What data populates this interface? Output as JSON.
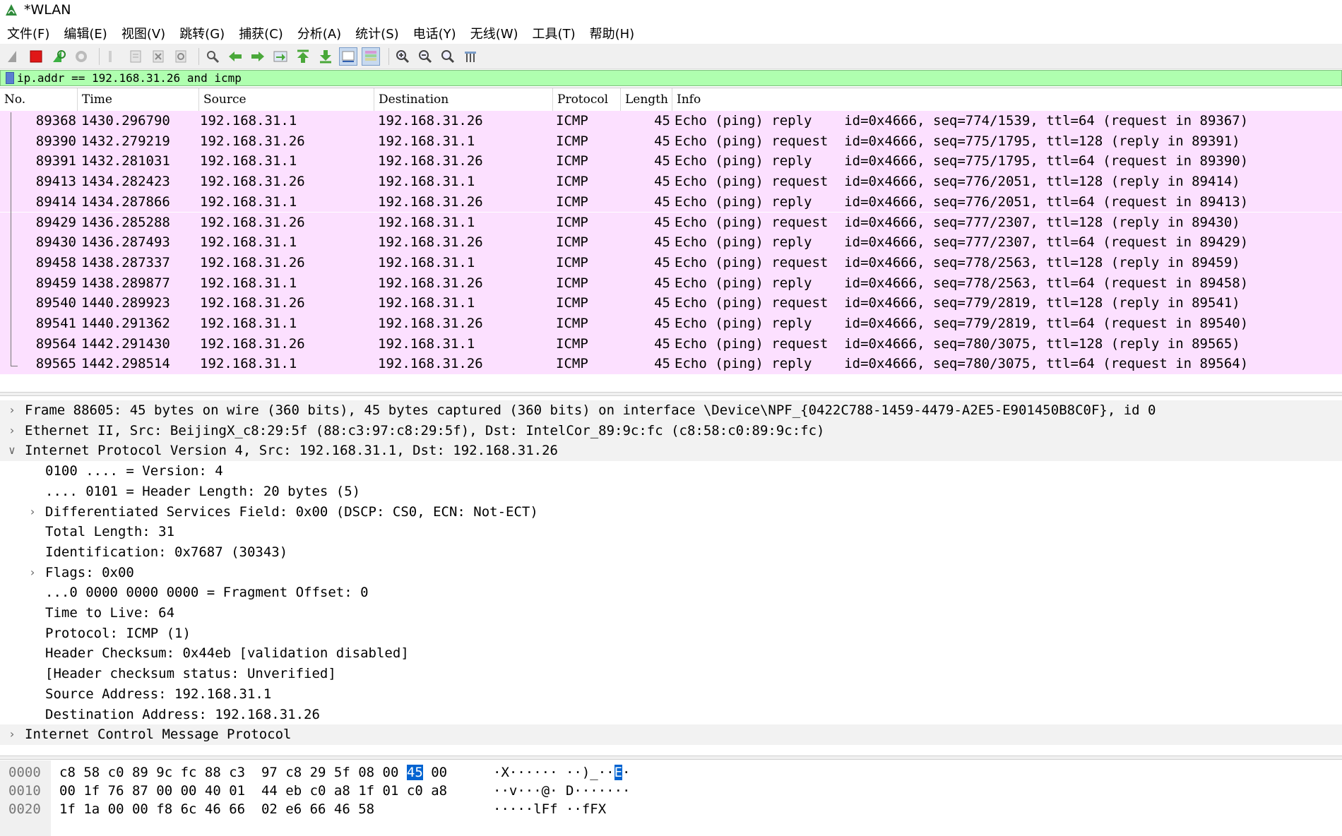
{
  "window": {
    "title": "*WLAN"
  },
  "menu": [
    "文件(F)",
    "编辑(E)",
    "视图(V)",
    "跳转(G)",
    "捕获(C)",
    "分析(A)",
    "统计(S)",
    "电话(Y)",
    "无线(W)",
    "工具(T)",
    "帮助(H)"
  ],
  "toolbar": {
    "icons": [
      "shark-fin-start-icon",
      "stop-capture-icon",
      "restart-capture-icon",
      "capture-options-icon",
      "open-file-icon",
      "save-file-icon",
      "close-file-icon",
      "reload-file-icon",
      "find-packet-icon",
      "go-back-icon",
      "go-forward-icon",
      "go-to-packet-icon",
      "go-first-icon",
      "go-last-icon",
      "auto-scroll-icon",
      "colorize-icon",
      "zoom-in-icon",
      "zoom-out-icon",
      "zoom-normal-icon",
      "resize-columns-icon"
    ]
  },
  "filter": {
    "value": "ip.addr == 192.168.31.26 and icmp"
  },
  "packet_list": {
    "columns": [
      "No.",
      "Time",
      "Source",
      "Destination",
      "Protocol",
      "Length",
      "Info"
    ],
    "rows": [
      {
        "no": "89368",
        "time": "1430.296790",
        "src": "192.168.31.1",
        "dst": "192.168.31.26",
        "proto": "ICMP",
        "len": "45",
        "info": "Echo (ping) reply    id=0x4666, seq=774/1539, ttl=64 (request in 89367)"
      },
      {
        "no": "89390",
        "time": "1432.279219",
        "src": "192.168.31.26",
        "dst": "192.168.31.1",
        "proto": "ICMP",
        "len": "45",
        "info": "Echo (ping) request  id=0x4666, seq=775/1795, ttl=128 (reply in 89391)"
      },
      {
        "no": "89391",
        "time": "1432.281031",
        "src": "192.168.31.1",
        "dst": "192.168.31.26",
        "proto": "ICMP",
        "len": "45",
        "info": "Echo (ping) reply    id=0x4666, seq=775/1795, ttl=64 (request in 89390)"
      },
      {
        "no": "89413",
        "time": "1434.282423",
        "src": "192.168.31.26",
        "dst": "192.168.31.1",
        "proto": "ICMP",
        "len": "45",
        "info": "Echo (ping) request  id=0x4666, seq=776/2051, ttl=128 (reply in 89414)"
      },
      {
        "no": "89414",
        "time": "1434.287866",
        "src": "192.168.31.1",
        "dst": "192.168.31.26",
        "proto": "ICMP",
        "len": "45",
        "info": "Echo (ping) reply    id=0x4666, seq=776/2051, ttl=64 (request in 89413)"
      },
      {
        "no": "89429",
        "time": "1436.285288",
        "src": "192.168.31.26",
        "dst": "192.168.31.1",
        "proto": "ICMP",
        "len": "45",
        "info": "Echo (ping) request  id=0x4666, seq=777/2307, ttl=128 (reply in 89430)"
      },
      {
        "no": "89430",
        "time": "1436.287493",
        "src": "192.168.31.1",
        "dst": "192.168.31.26",
        "proto": "ICMP",
        "len": "45",
        "info": "Echo (ping) reply    id=0x4666, seq=777/2307, ttl=64 (request in 89429)"
      },
      {
        "no": "89458",
        "time": "1438.287337",
        "src": "192.168.31.26",
        "dst": "192.168.31.1",
        "proto": "ICMP",
        "len": "45",
        "info": "Echo (ping) request  id=0x4666, seq=778/2563, ttl=128 (reply in 89459)"
      },
      {
        "no": "89459",
        "time": "1438.289877",
        "src": "192.168.31.1",
        "dst": "192.168.31.26",
        "proto": "ICMP",
        "len": "45",
        "info": "Echo (ping) reply    id=0x4666, seq=778/2563, ttl=64 (request in 89458)"
      },
      {
        "no": "89540",
        "time": "1440.289923",
        "src": "192.168.31.26",
        "dst": "192.168.31.1",
        "proto": "ICMP",
        "len": "45",
        "info": "Echo (ping) request  id=0x4666, seq=779/2819, ttl=128 (reply in 89541)"
      },
      {
        "no": "89541",
        "time": "1440.291362",
        "src": "192.168.31.1",
        "dst": "192.168.31.26",
        "proto": "ICMP",
        "len": "45",
        "info": "Echo (ping) reply    id=0x4666, seq=779/2819, ttl=64 (request in 89540)"
      },
      {
        "no": "89564",
        "time": "1442.291430",
        "src": "192.168.31.26",
        "dst": "192.168.31.1",
        "proto": "ICMP",
        "len": "45",
        "info": "Echo (ping) request  id=0x4666, seq=780/3075, ttl=128 (reply in 89565)"
      },
      {
        "no": "89565",
        "time": "1442.298514",
        "src": "192.168.31.1",
        "dst": "192.168.31.26",
        "proto": "ICMP",
        "len": "45",
        "info": "Echo (ping) reply    id=0x4666, seq=780/3075, ttl=64 (request in 89564)"
      }
    ]
  },
  "details": [
    {
      "text": "Frame 88605: 45 bytes on wire (360 bits), 45 bytes captured (360 bits) on interface \\Device\\NPF_{0422C788-1459-4479-A2E5-E901450B8C0F}, id 0",
      "level": 0,
      "expander": "collapsed"
    },
    {
      "text": "Ethernet II, Src: BeijingX_c8:29:5f (88:c3:97:c8:29:5f), Dst: IntelCor_89:9c:fc (c8:58:c0:89:9c:fc)",
      "level": 0,
      "expander": "collapsed"
    },
    {
      "text": "Internet Protocol Version 4, Src: 192.168.31.1, Dst: 192.168.31.26",
      "level": 0,
      "expander": "expanded"
    },
    {
      "text": "0100 .... = Version: 4",
      "level": 1,
      "expander": "none"
    },
    {
      "text": ".... 0101 = Header Length: 20 bytes (5)",
      "level": 1,
      "expander": "none"
    },
    {
      "text": "Differentiated Services Field: 0x00 (DSCP: CS0, ECN: Not-ECT)",
      "level": 1,
      "expander": "collapsed"
    },
    {
      "text": "Total Length: 31",
      "level": 1,
      "expander": "none"
    },
    {
      "text": "Identification: 0x7687 (30343)",
      "level": 1,
      "expander": "none"
    },
    {
      "text": "Flags: 0x00",
      "level": 1,
      "expander": "collapsed"
    },
    {
      "text": "...0 0000 0000 0000 = Fragment Offset: 0",
      "level": 1,
      "expander": "none"
    },
    {
      "text": "Time to Live: 64",
      "level": 1,
      "expander": "none"
    },
    {
      "text": "Protocol: ICMP (1)",
      "level": 1,
      "expander": "none"
    },
    {
      "text": "Header Checksum: 0x44eb [validation disabled]",
      "level": 1,
      "expander": "none"
    },
    {
      "text": "[Header checksum status: Unverified]",
      "level": 1,
      "expander": "none"
    },
    {
      "text": "Source Address: 192.168.31.1",
      "level": 1,
      "expander": "none"
    },
    {
      "text": "Destination Address: 192.168.31.26",
      "level": 1,
      "expander": "none"
    },
    {
      "text": "Internet Control Message Protocol",
      "level": 0,
      "expander": "collapsed"
    }
  ],
  "bytes": [
    {
      "offset": "0000",
      "hex_a": "c8 58 c0 89 9c fc 88 c3  97 c8 29 5f 08 00 ",
      "hex_hl": "45",
      "hex_b": " 00",
      "ascii_a": "·X······ ··)_··",
      "ascii_hl": "E",
      "ascii_b": "·"
    },
    {
      "offset": "0010",
      "hex_a": "00 1f 76 87 00 00 40 01  44 eb c0 a8 1f 01 c0 a8",
      "hex_hl": "",
      "hex_b": "",
      "ascii_a": "··v···@· D·······",
      "ascii_hl": "",
      "ascii_b": ""
    },
    {
      "offset": "0020",
      "hex_a": "1f 1a 00 00 f8 6c 46 66  02 e6 66 46 58",
      "hex_hl": "",
      "hex_b": "",
      "ascii_a": "·····lFf ··fFX",
      "ascii_hl": "",
      "ascii_b": ""
    }
  ],
  "colors": {
    "icmp_row_bg": "#fce0ff",
    "filter_valid_bg": "#afffaf",
    "byte_highlight": "#0063d1"
  }
}
